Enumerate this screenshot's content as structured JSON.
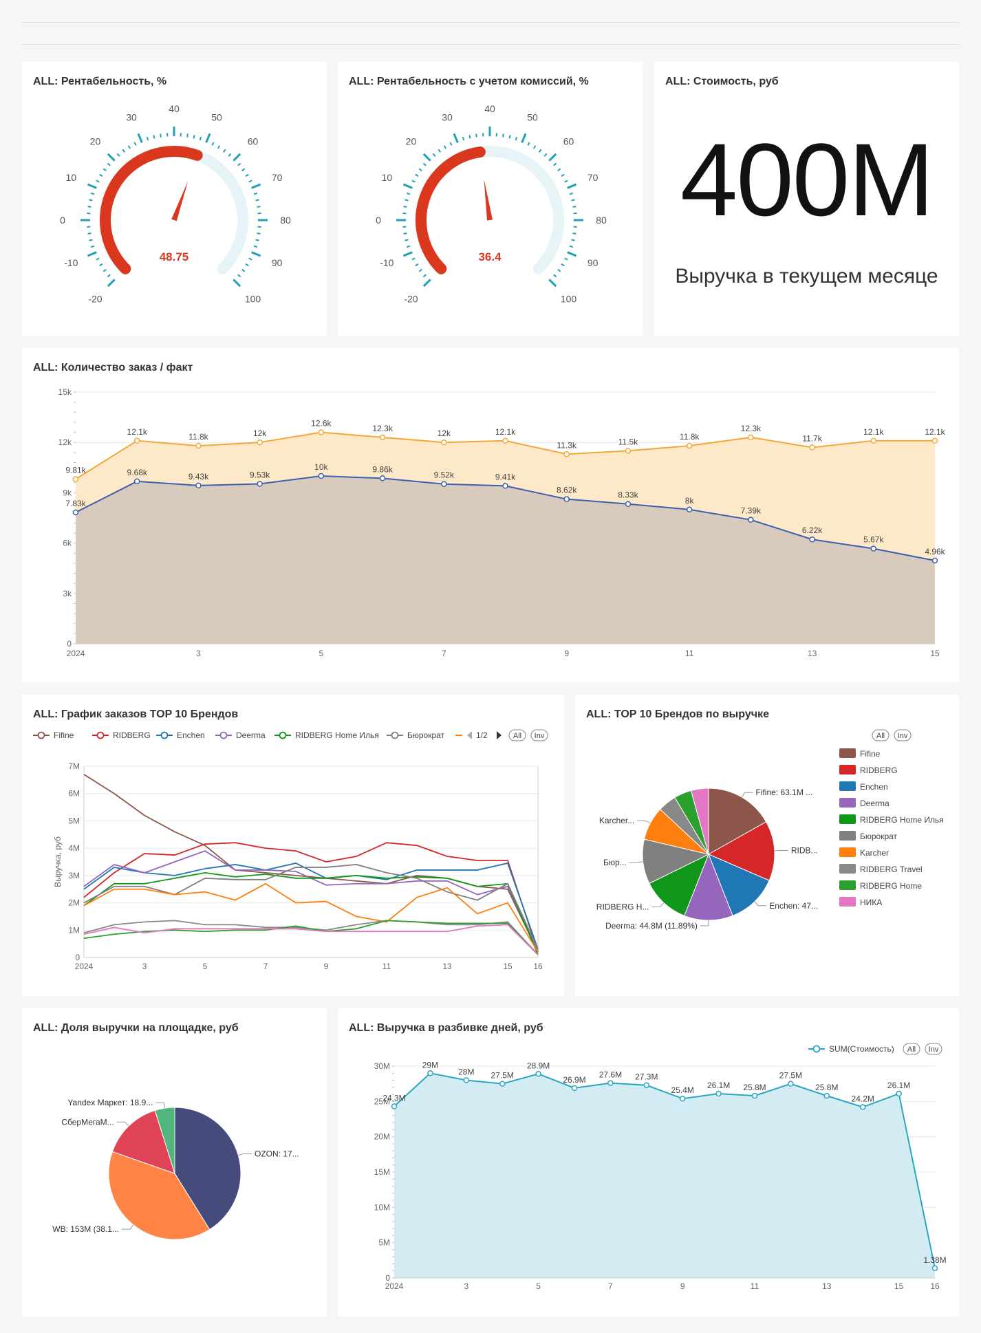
{
  "gauges": [
    {
      "title": "ALL: Рентабельность, %",
      "value": 48.75,
      "value_label": "48.75",
      "min": -20,
      "max": 100,
      "ticks": [
        "-20",
        "-10",
        "0",
        "10",
        "20",
        "30",
        "40",
        "50",
        "60",
        "70",
        "80",
        "90",
        "100"
      ]
    },
    {
      "title": "ALL: Рентабельность с учетом комиссий, %",
      "value": 36.4,
      "value_label": "36.4",
      "min": -20,
      "max": 100,
      "ticks": [
        "-20",
        "-10",
        "0",
        "10",
        "20",
        "30",
        "40",
        "50",
        "60",
        "70",
        "80",
        "90",
        "100"
      ]
    }
  ],
  "big_number": {
    "title": "ALL: Стоимость, руб",
    "value": "400M",
    "subtitle": "Выручка в текущем месяце"
  },
  "colors": {
    "orange": "#f4a73a",
    "blue": "#3d5fb1",
    "red_arc": "#d9381e",
    "teal": "#2aa6c0",
    "pie1": "#8c564b",
    "pie2": "#d62728",
    "pie3": "#1f77b4",
    "pie4": "#9467bd",
    "pie5": "#109618",
    "pie6": "#7f7f7f",
    "pie7": "#ff7f0e",
    "pie8": "#888888",
    "pie9": "#2ca02c",
    "pie10": "#e377c2"
  },
  "chart_data": [
    {
      "type": "area",
      "title": "ALL: Количество заказ / факт",
      "x_ticks": [
        "2024",
        "3",
        "5",
        "7",
        "9",
        "11",
        "13",
        "15"
      ],
      "y_ticks": [
        "0",
        "3k",
        "6k",
        "9k",
        "12k",
        "15k"
      ],
      "ylim": [
        0,
        15000
      ],
      "x": [
        1,
        2,
        3,
        4,
        5,
        6,
        7,
        8,
        9,
        10,
        11,
        12,
        13,
        14,
        15
      ],
      "series": [
        {
          "values": [
            9810,
            12100,
            11800,
            12000,
            12600,
            12300,
            12000,
            12100,
            11300,
            11500,
            11800,
            12300,
            11700,
            12100,
            12100
          ],
          "labels": [
            "9.81k",
            "12.1k",
            "11.8k",
            "12k",
            "12.6k",
            "12.3k",
            "12k",
            "12.1k",
            "11.3k",
            "11.5k",
            "11.8k",
            "12.3k",
            "11.7k",
            "12.1k",
            "12.1k"
          ]
        },
        {
          "values": [
            7830,
            9680,
            9430,
            9530,
            10000,
            9860,
            9520,
            9410,
            8620,
            8330,
            8000,
            7390,
            6220,
            5670,
            4960
          ],
          "labels": [
            "7.83k",
            "9.68k",
            "9.43k",
            "9.53k",
            "10k",
            "9.86k",
            "9.52k",
            "9.41k",
            "8.62k",
            "8.33k",
            "8k",
            "7.39k",
            "6.22k",
            "5.67k",
            "4.96k"
          ]
        }
      ]
    },
    {
      "type": "line",
      "title": "ALL: График заказов TOP 10 Брендов",
      "ylabel": "Выручка, руб",
      "x_ticks": [
        "2024",
        "3",
        "5",
        "7",
        "9",
        "11",
        "13",
        "15",
        "16"
      ],
      "y_ticks": [
        "0",
        "1M",
        "2M",
        "3M",
        "4M",
        "5M",
        "6M",
        "7M"
      ],
      "ylim": [
        0,
        7
      ],
      "legend_page": "1/2",
      "legend_buttons": [
        "All",
        "Inv"
      ],
      "x": [
        1,
        2,
        3,
        4,
        5,
        6,
        7,
        8,
        9,
        10,
        11,
        12,
        13,
        14,
        15,
        16
      ],
      "series": [
        {
          "name": "Fifine",
          "color": "#8c564b",
          "values": [
            6.7,
            6.0,
            5.2,
            4.6,
            4.1,
            3.2,
            3.1,
            3.0,
            2.9,
            2.8,
            2.7,
            3.0,
            2.9,
            2.6,
            2.5,
            0.2
          ]
        },
        {
          "name": "RIDBERG",
          "color": "#d62728",
          "values": [
            2.2,
            3.1,
            3.8,
            3.75,
            4.15,
            4.2,
            4.0,
            3.9,
            3.5,
            3.7,
            4.2,
            4.1,
            3.7,
            3.55,
            3.55,
            0.2
          ]
        },
        {
          "name": "Enchen",
          "color": "#1f77b4",
          "values": [
            2.5,
            3.3,
            3.1,
            3.0,
            3.25,
            3.4,
            3.2,
            3.45,
            2.9,
            3.0,
            2.85,
            3.2,
            3.2,
            3.2,
            3.45,
            0.3
          ]
        },
        {
          "name": "Deerma",
          "color": "#9467bd",
          "values": [
            2.6,
            3.4,
            3.1,
            3.5,
            3.9,
            3.2,
            3.2,
            3.15,
            2.65,
            2.7,
            2.7,
            2.8,
            2.8,
            2.3,
            2.6,
            0.2
          ]
        },
        {
          "name": "RIDBERG Home Илья",
          "color": "#109618",
          "values": [
            1.9,
            2.7,
            2.7,
            2.9,
            3.1,
            2.95,
            3.05,
            2.9,
            2.9,
            3.0,
            2.9,
            2.95,
            2.9,
            2.6,
            2.7,
            0.1
          ]
        },
        {
          "name": "Бюрократ",
          "color": "#7f7f7f",
          "values": [
            2.0,
            2.6,
            2.6,
            2.3,
            2.9,
            2.85,
            2.85,
            3.3,
            3.3,
            3.4,
            3.1,
            2.9,
            2.4,
            2.1,
            2.7,
            0.3
          ]
        },
        {
          "color": "#ff7f0e",
          "values": [
            1.9,
            2.5,
            2.5,
            2.3,
            2.4,
            2.1,
            2.7,
            2.0,
            2.05,
            1.5,
            1.3,
            2.2,
            2.55,
            1.6,
            2.0,
            0.2
          ]
        },
        {
          "color": "#888888",
          "values": [
            0.9,
            1.2,
            1.3,
            1.35,
            1.2,
            1.2,
            1.1,
            1.1,
            1.0,
            1.2,
            1.35,
            1.3,
            1.2,
            1.2,
            1.3,
            0.1
          ]
        },
        {
          "color": "#2ca02c",
          "values": [
            0.7,
            0.85,
            0.95,
            1.0,
            0.95,
            1.0,
            1.0,
            1.15,
            0.95,
            1.05,
            1.35,
            1.3,
            1.25,
            1.25,
            1.25,
            0.1
          ]
        },
        {
          "color": "#e377c2",
          "values": [
            0.85,
            1.1,
            0.9,
            1.05,
            1.05,
            1.05,
            1.05,
            1.05,
            0.95,
            0.95,
            0.95,
            0.95,
            0.95,
            1.15,
            1.2,
            0.1
          ]
        }
      ]
    },
    {
      "type": "pie",
      "title": "ALL: TOP 10 Брендов по выручке",
      "legend_buttons": [
        "All",
        "Inv"
      ],
      "slices": [
        {
          "name": "Fifine",
          "value": 63.1,
          "label": "Fifine: 63.1M ...",
          "color": "#8c564b"
        },
        {
          "name": "RIDBERG",
          "value": 55.0,
          "label": "RIDB...",
          "color": "#d62728"
        },
        {
          "name": "Enchen",
          "value": 47.0,
          "label": "Enchen: 47...",
          "color": "#1f77b4"
        },
        {
          "name": "Deerma",
          "value": 44.8,
          "label": "Deerma: 44.8M (11.89%)",
          "color": "#9467bd"
        },
        {
          "name": "RIDBERG Home Илья",
          "value": 44.0,
          "label": "RIDBERG H...",
          "color": "#109618"
        },
        {
          "name": "Бюрократ",
          "value": 41.0,
          "label": "Бюр...",
          "color": "#7f7f7f"
        },
        {
          "name": "Karcher",
          "value": 31.0,
          "label": "Karcher...",
          "color": "#ff7f0e"
        },
        {
          "name": "RIDBERG Travel",
          "value": 17.0,
          "label": "",
          "color": "#888888"
        },
        {
          "name": "RIDBERG Home",
          "value": 16.0,
          "label": "",
          "color": "#2ca02c"
        },
        {
          "name": "НИКА",
          "value": 16.0,
          "label": "",
          "color": "#e377c2"
        }
      ]
    },
    {
      "type": "pie",
      "title": "ALL: Доля выручки на площадке, руб",
      "slices": [
        {
          "name": "OZON",
          "value": 40.0,
          "label": "OZON: 17...",
          "color": "#454b7a"
        },
        {
          "name": "WB",
          "value": 38.1,
          "label": "WB: 153M (38.1...",
          "color": "#ff8446"
        },
        {
          "name": "СберМегаМаркет",
          "value": 14.4,
          "label": "СберМегаМ...",
          "color": "#e04358"
        },
        {
          "name": "Yandex Маркет",
          "value": 4.7,
          "label": "Yandex Маркет: 18.9...",
          "color": "#50b67b"
        }
      ]
    },
    {
      "type": "area",
      "title": "ALL: Выручка в разбивке дней, руб",
      "x_ticks": [
        "2024",
        "3",
        "5",
        "7",
        "9",
        "11",
        "13",
        "15",
        "16"
      ],
      "y_ticks": [
        "0",
        "5M",
        "10M",
        "15M",
        "20M",
        "25M",
        "30M"
      ],
      "ylim": [
        0,
        30
      ],
      "legend_buttons": [
        "All",
        "Inv"
      ],
      "x": [
        1,
        2,
        3,
        4,
        5,
        6,
        7,
        8,
        9,
        10,
        11,
        12,
        13,
        14,
        15,
        16
      ],
      "series": [
        {
          "name": "SUM(Стоимость)",
          "color": "#2aa6c0",
          "values": [
            24.3,
            29,
            28,
            27.5,
            28.9,
            26.9,
            27.6,
            27.3,
            25.4,
            26.1,
            25.8,
            27.5,
            25.8,
            24.2,
            26.1,
            1.38
          ],
          "labels": [
            "24.3M",
            "29M",
            "28M",
            "27.5M",
            "28.9M",
            "26.9M",
            "27.6M",
            "27.3M",
            "25.4M",
            "26.1M",
            "25.8M",
            "27.5M",
            "25.8M",
            "24.2M",
            "26.1M",
            "1.38M"
          ]
        }
      ]
    }
  ]
}
